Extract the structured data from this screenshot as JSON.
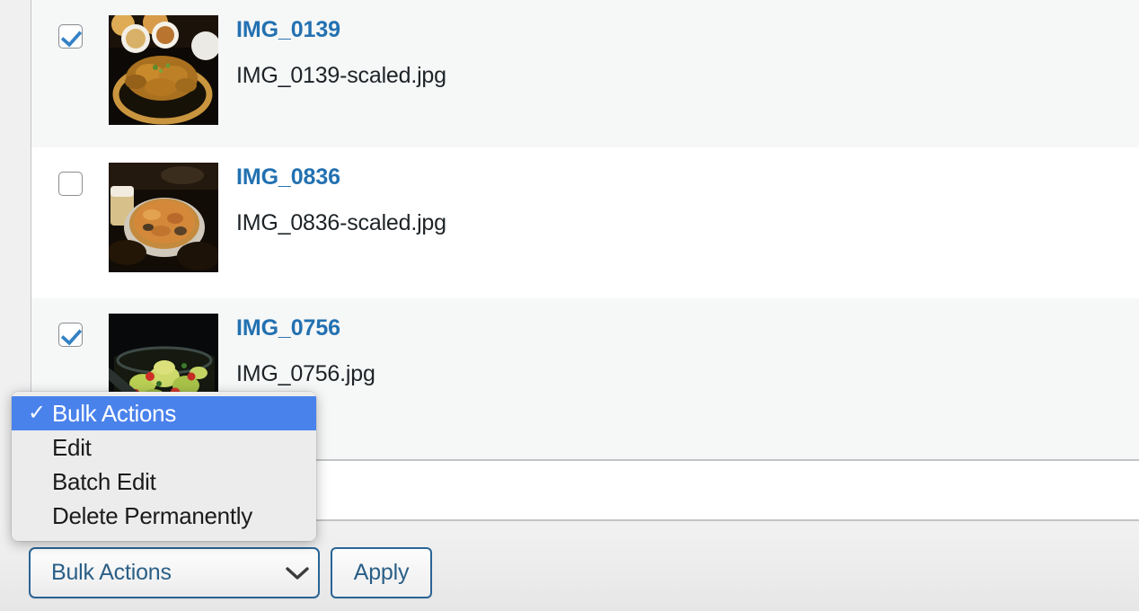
{
  "colors": {
    "link_blue": "#2271b1",
    "checkbox_blue": "#3582c4",
    "control_border_blue": "#2a6496",
    "control_text_blue": "#2a5f87",
    "popup_highlight_blue": "#4a82ec",
    "row_stripe": "#f6f7f7",
    "row_plain": "#ffffff",
    "page_background": "#f0f0f1",
    "table_border": "#c3c4c7",
    "popup_background": "#ececec"
  },
  "media_list": {
    "rows": [
      {
        "checked": true,
        "striped": true,
        "title": "IMG_0139",
        "filename": "IMG_0139-scaled.jpg",
        "thumbnail_alt": "korean-fried-chicken-sizzling-plate-thumbnail"
      },
      {
        "checked": false,
        "striped": false,
        "title": "IMG_0836",
        "filename": "IMG_0836-scaled.jpg",
        "thumbnail_alt": "pizza-and-beer-on-table-thumbnail"
      },
      {
        "checked": true,
        "striped": true,
        "title": "IMG_0756",
        "filename": "IMG_0756.jpg",
        "thumbnail_alt": "green-salad-with-tomatoes-thumbnail"
      }
    ]
  },
  "bulk_actions": {
    "select_value": "Bulk Actions",
    "chevron_icon": "chevron-down-icon",
    "apply_label": "Apply",
    "options": [
      {
        "label": "Bulk Actions",
        "selected": true,
        "check_glyph": "✓"
      },
      {
        "label": "Edit",
        "selected": false,
        "check_glyph": ""
      },
      {
        "label": "Batch Edit",
        "selected": false,
        "check_glyph": ""
      },
      {
        "label": "Delete Permanently",
        "selected": false,
        "check_glyph": ""
      }
    ]
  }
}
